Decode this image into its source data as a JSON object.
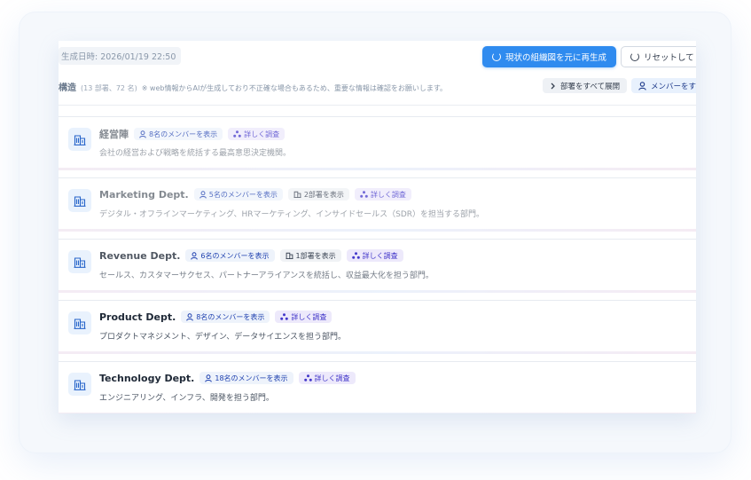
{
  "header": {
    "generated_label": "生成日時: 2026/01/19 22:50",
    "regenerate_label": "現状の組織図を元に再生成",
    "reset_label": "リセットして"
  },
  "subheader": {
    "title": "構造",
    "count": "(13 部署、72 名)",
    "note": "※ web情報からAIが生成しており不正確な場合もあるため、重要な情報は確認をお願いします。",
    "expand_all": "部署をすべて展開",
    "members_all": "メンバーをすべ"
  },
  "departments": [
    {
      "name": "経営陣",
      "members": "8名のメンバーを表示",
      "subdepts": "",
      "research": "詳しく調査",
      "description": "会社の経営および戦略を統括する最高意思決定機関。"
    },
    {
      "name": "Marketing Dept.",
      "members": "5名のメンバーを表示",
      "subdepts": "2部署を表示",
      "research": "詳しく調査",
      "description": "デジタル・オフラインマーケティング、HRマーケティング、インサイドセールス（SDR）を担当する部門。"
    },
    {
      "name": "Revenue Dept.",
      "members": "6名のメンバーを表示",
      "subdepts": "1部署を表示",
      "research": "詳しく調査",
      "description": "セールス、カスタマーサクセス、パートナーアライアンスを統括し、収益最大化を担う部門。"
    },
    {
      "name": "Product Dept.",
      "members": "8名のメンバーを表示",
      "subdepts": "",
      "research": "詳しく調査",
      "description": "プロダクトマネジメント、デザイン、データサイエンスを担う部門。"
    },
    {
      "name": "Technology Dept.",
      "members": "18名のメンバーを表示",
      "subdepts": "",
      "research": "詳しく調査",
      "description": "エンジニアリング、インフラ、開発を担う部門。"
    }
  ],
  "colors": {
    "accent": "#2f8bef",
    "icon_bg": "#e9f2fd",
    "pill_bg": "#eef3fb",
    "research_bg": "#ede9fb"
  },
  "icons": {
    "dept": "building-icon",
    "members": "user-icon",
    "subdepts": "building-small-icon",
    "research": "sitemap-icon",
    "refresh": "refresh-icon",
    "expand": "chevron-right-icon"
  }
}
